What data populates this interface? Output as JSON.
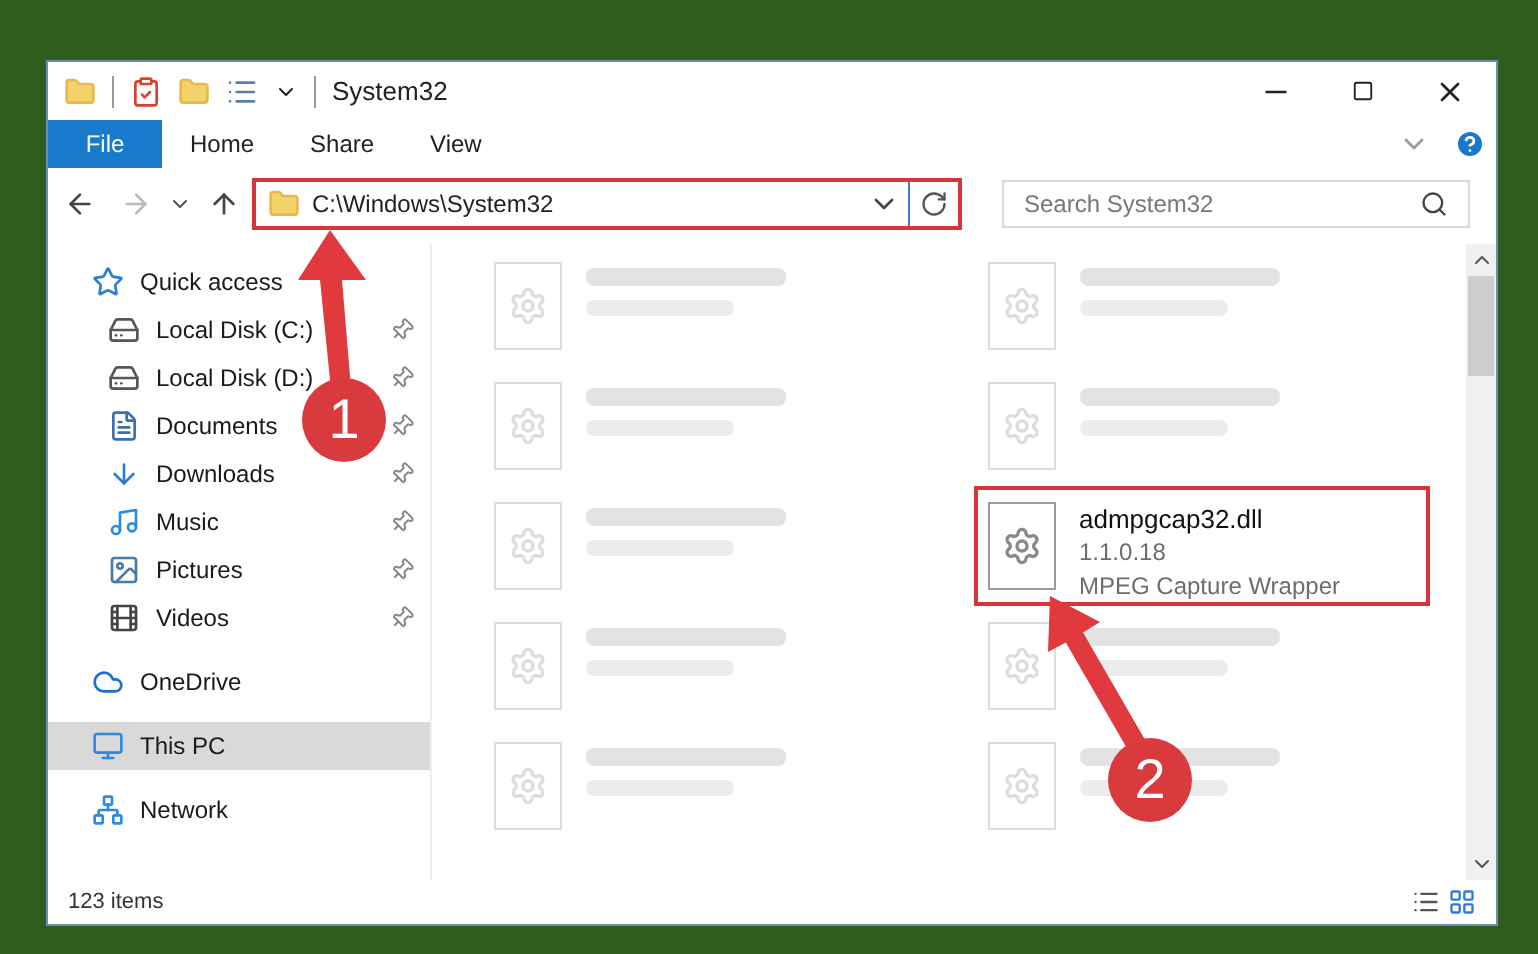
{
  "window": {
    "title": "System32"
  },
  "ribbon_tabs": [
    {
      "label": "File",
      "kind": "file"
    },
    {
      "label": "Home",
      "kind": "tab"
    },
    {
      "label": "Share",
      "kind": "tab"
    },
    {
      "label": "View",
      "kind": "tab"
    }
  ],
  "address_bar": {
    "value": "C:\\Windows\\System32",
    "highlighted": true
  },
  "search": {
    "placeholder": "Search System32"
  },
  "sidebar": {
    "items": [
      {
        "label": "Quick access",
        "kind": "star",
        "selected": false,
        "children": [
          {
            "label": "Local Disk (C:)",
            "kind": "drive",
            "pinned": true,
            "selected": false
          },
          {
            "label": "Local Disk (D:)",
            "kind": "drive",
            "pinned": true,
            "selected": false
          },
          {
            "label": "Documents",
            "kind": "document",
            "pinned": true,
            "selected": false
          },
          {
            "label": "Downloads",
            "kind": "download",
            "pinned": true,
            "selected": false
          },
          {
            "label": "Music",
            "kind": "music",
            "pinned": true,
            "selected": false
          },
          {
            "label": "Pictures",
            "kind": "pictures",
            "pinned": true,
            "selected": false
          },
          {
            "label": "Videos",
            "kind": "videos",
            "pinned": true,
            "selected": false
          }
        ]
      },
      {
        "label": "OneDrive",
        "kind": "cloud",
        "selected": false
      },
      {
        "label": "This PC",
        "kind": "computer",
        "selected": true
      },
      {
        "label": "Network",
        "kind": "network",
        "selected": false
      }
    ]
  },
  "files": [
    {
      "blurred": true
    },
    {
      "blurred": true
    },
    {
      "blurred": true
    },
    {
      "blurred": true
    },
    {
      "blurred": true
    },
    {
      "name": "admpgcap32.dll",
      "details": [
        "1.1.0.18",
        "MPEG Capture Wrapper"
      ],
      "blurred": false,
      "highlighted": true
    },
    {
      "blurred": true
    },
    {
      "blurred": true
    },
    {
      "blurred": true
    },
    {
      "blurred": true
    }
  ],
  "status_bar": {
    "item_count": "123 items"
  },
  "annotations": [
    {
      "number": "1"
    },
    {
      "number": "2"
    }
  ]
}
